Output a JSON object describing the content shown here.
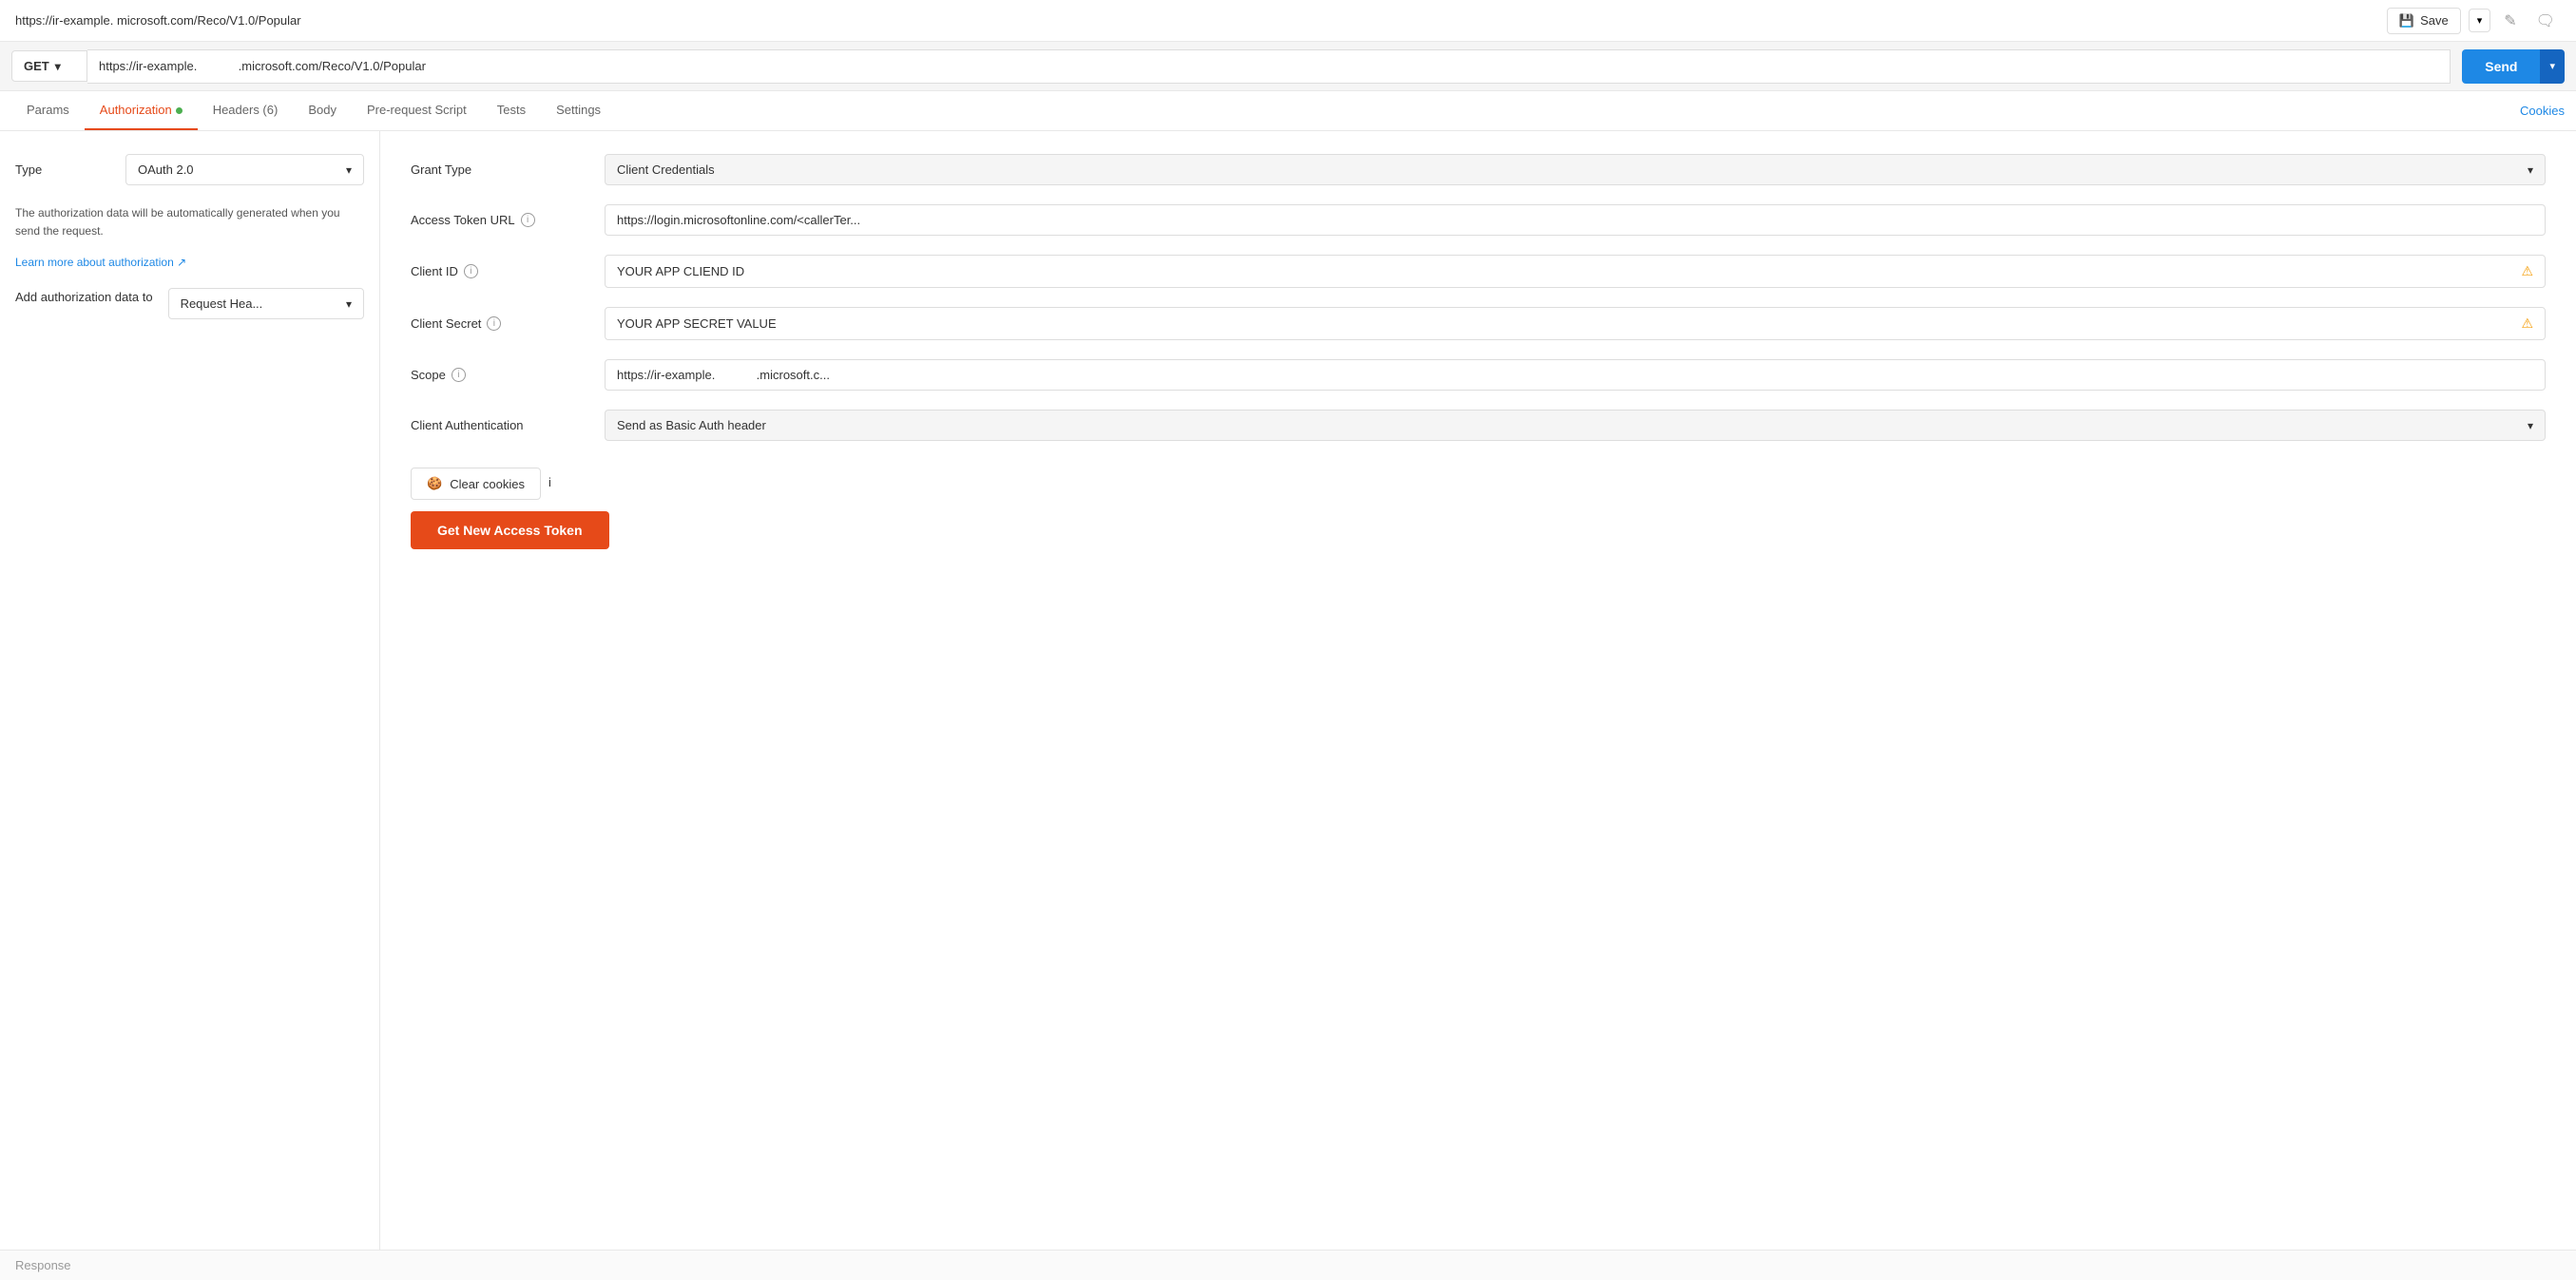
{
  "topBar": {
    "urlLeft": "https://ir-example.",
    "urlRight": "microsoft.com/Reco/V1.0/Popular",
    "saveLabel": "Save",
    "editIcon": "✎",
    "commentIcon": "💬"
  },
  "urlBar": {
    "method": "GET",
    "urlFull": "https://ir-example.            .microsoft.com/Reco/V1.0/Popular",
    "sendLabel": "Send"
  },
  "tabs": [
    {
      "id": "params",
      "label": "Params",
      "active": false
    },
    {
      "id": "authorization",
      "label": "Authorization",
      "active": true,
      "dot": true
    },
    {
      "id": "headers",
      "label": "Headers (6)",
      "active": false
    },
    {
      "id": "body",
      "label": "Body",
      "active": false
    },
    {
      "id": "prerequest",
      "label": "Pre-request Script",
      "active": false
    },
    {
      "id": "tests",
      "label": "Tests",
      "active": false
    },
    {
      "id": "settings",
      "label": "Settings",
      "active": false
    }
  ],
  "cookiesLink": "Cookies",
  "leftPanel": {
    "typeLabel": "Type",
    "typeValue": "OAuth 2.0",
    "infoText": "The authorization data will be automatically generated when you send the request.",
    "learnMoreLabel": "Learn more about authorization",
    "learnMoreArrow": "↗",
    "addAuthLabel": "Add authorization data to",
    "addAuthValue": "Request Hea..."
  },
  "rightPanel": {
    "fields": [
      {
        "id": "grant-type",
        "label": "Grant Type",
        "type": "select",
        "value": "Client Credentials",
        "hasInfo": false,
        "hasWarning": false
      },
      {
        "id": "access-token-url",
        "label": "Access Token URL",
        "type": "input",
        "value": "https://login.microsoftonline.com/<callerTer...",
        "hasInfo": true,
        "hasWarning": false
      },
      {
        "id": "client-id",
        "label": "Client ID",
        "type": "input-warning",
        "value": "YOUR  APP  CLIEND  ID",
        "hasInfo": true,
        "hasWarning": true
      },
      {
        "id": "client-secret",
        "label": "Client Secret",
        "type": "input-warning",
        "value": "YOUR  APP  SECRET  VALUE",
        "hasInfo": true,
        "hasWarning": true
      },
      {
        "id": "scope",
        "label": "Scope",
        "type": "input",
        "value": "https://ir-example.            .microsoft.c...",
        "hasInfo": true,
        "hasWarning": false
      },
      {
        "id": "client-auth",
        "label": "Client Authentication",
        "type": "select",
        "value": "Send as Basic Auth header",
        "hasInfo": false,
        "hasWarning": false
      }
    ],
    "clearCookiesLabel": "Clear cookies",
    "clearCookiesIcon": "🍪",
    "getTokenLabel": "Get New Access Token"
  },
  "response": {
    "label": "Response"
  }
}
